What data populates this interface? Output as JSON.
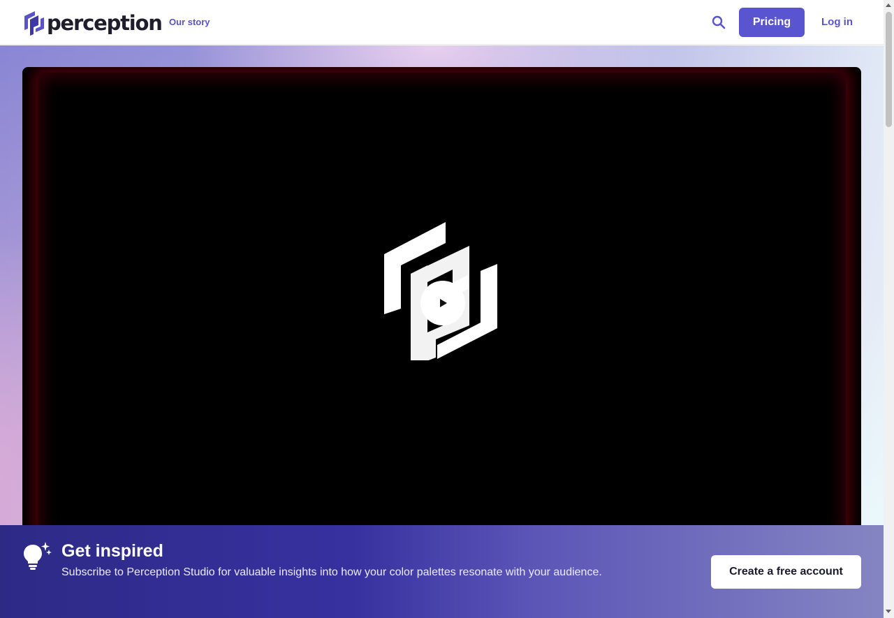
{
  "header": {
    "brand": "perception",
    "nav_story": "Our story",
    "pricing_label": "Pricing",
    "login_label": "Log in"
  },
  "colors": {
    "accent": "#5954d0",
    "banner_start": "#2d2a86",
    "banner_end": "#8585c2"
  },
  "video": {
    "play_icon": "play-icon"
  },
  "banner": {
    "title": "Get inspired",
    "text": "Subscribe to Perception Studio for valuable insights into how your color palettes resonate with your audience.",
    "cta_label": "Create a free account"
  }
}
